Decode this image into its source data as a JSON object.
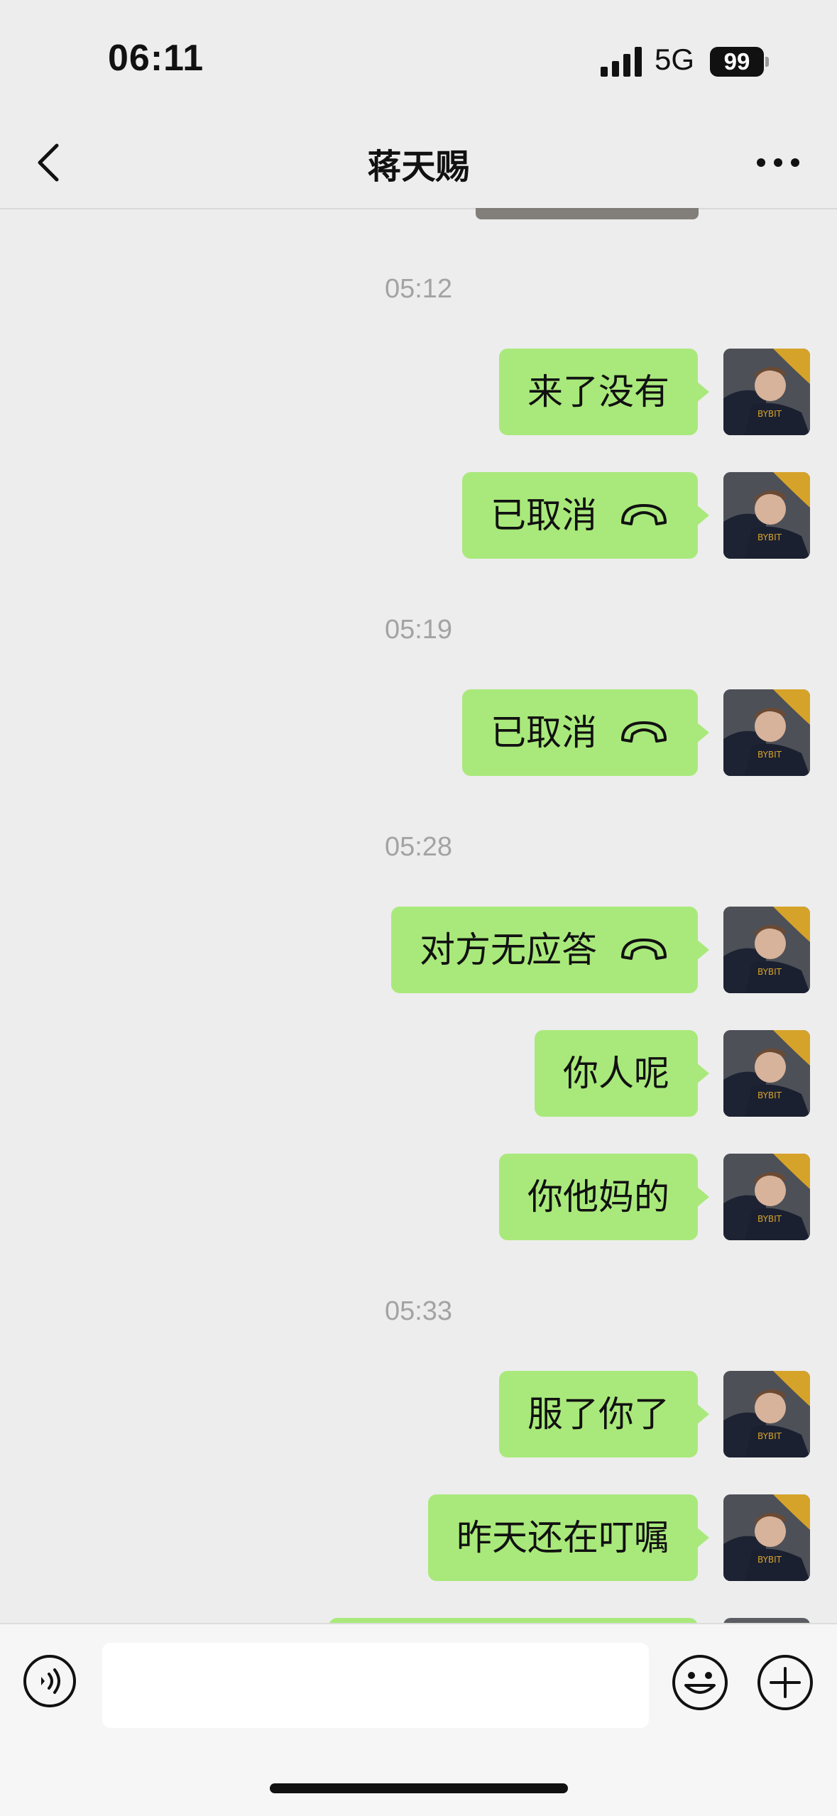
{
  "status_bar": {
    "time": "06:11",
    "network": "5G",
    "battery": "99"
  },
  "nav": {
    "title": "蒋天赐"
  },
  "messages": [
    {
      "timestamp": "05:12"
    },
    {
      "text": "来了没有",
      "from": "me"
    },
    {
      "text": "已取消",
      "from": "me",
      "icon": "call-icon"
    },
    {
      "timestamp": "05:19"
    },
    {
      "text": "已取消",
      "from": "me",
      "icon": "call-icon"
    },
    {
      "timestamp": "05:28"
    },
    {
      "text": "对方无应答",
      "from": "me",
      "icon": "call-icon"
    },
    {
      "text": "你人呢",
      "from": "me"
    },
    {
      "text": "你他妈的",
      "from": "me"
    },
    {
      "timestamp": "05:33"
    },
    {
      "text": "服了你了",
      "from": "me"
    },
    {
      "text": "昨天还在叮嘱",
      "from": "me"
    }
  ],
  "input": {
    "value": "",
    "placeholder": ""
  },
  "colors": {
    "background": "#ededed",
    "bubble_sent": "#a9e97b",
    "timestamp_text": "#a3a3a3"
  }
}
